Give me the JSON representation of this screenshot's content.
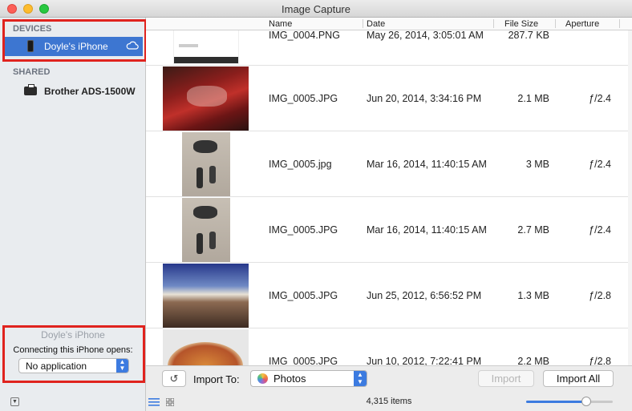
{
  "window": {
    "title": "Image Capture"
  },
  "sidebar": {
    "devices_header": "DEVICES",
    "device_name": "Doyle's iPhone",
    "shared_header": "SHARED",
    "shared_device": "Brother ADS-1500W",
    "device_panel": {
      "name": "Doyle's iPhone",
      "caption": "Connecting this iPhone opens:",
      "selected_app": "No application"
    }
  },
  "columns": {
    "name": "Name",
    "date": "Date",
    "size": "File Size",
    "aperture": "Aperture"
  },
  "rows": [
    {
      "name": "IMG_0004.PNG",
      "date": "May 26, 2014, 3:05:01 AM",
      "size": "287.7 KB",
      "aperture": ""
    },
    {
      "name": "IMG_0005.JPG",
      "date": "Jun 20, 2014, 3:34:16 PM",
      "size": "2.1 MB",
      "aperture": "ƒ/2.4"
    },
    {
      "name": "IMG_0005.jpg",
      "date": "Mar 16, 2014, 11:40:15 AM",
      "size": "3 MB",
      "aperture": "ƒ/2.4"
    },
    {
      "name": "IMG_0005.JPG",
      "date": "Mar 16, 2014, 11:40:15 AM",
      "size": "2.7 MB",
      "aperture": "ƒ/2.4"
    },
    {
      "name": "IMG_0005.JPG",
      "date": "Jun 25, 2012, 6:56:52 PM",
      "size": "1.3 MB",
      "aperture": "ƒ/2.8"
    },
    {
      "name": "IMG_0005.JPG",
      "date": "Jun 10, 2012, 7:22:41 PM",
      "size": "2.2 MB",
      "aperture": "ƒ/2.8"
    }
  ],
  "toolbar": {
    "import_to_label": "Import To:",
    "destination": "Photos",
    "import_label": "Import",
    "import_all_label": "Import All",
    "item_count": "4,315 items",
    "thumbnail_size": 0.72
  },
  "icons": {
    "rotate": "rotate-left-icon",
    "cloud": "cloud-icon",
    "list_view": "list-view-icon",
    "grid_view": "grid-view-icon"
  },
  "colors": {
    "selection": "#3d76d1",
    "accent": "#3c7be0",
    "highlight_box": "#e0231e"
  }
}
